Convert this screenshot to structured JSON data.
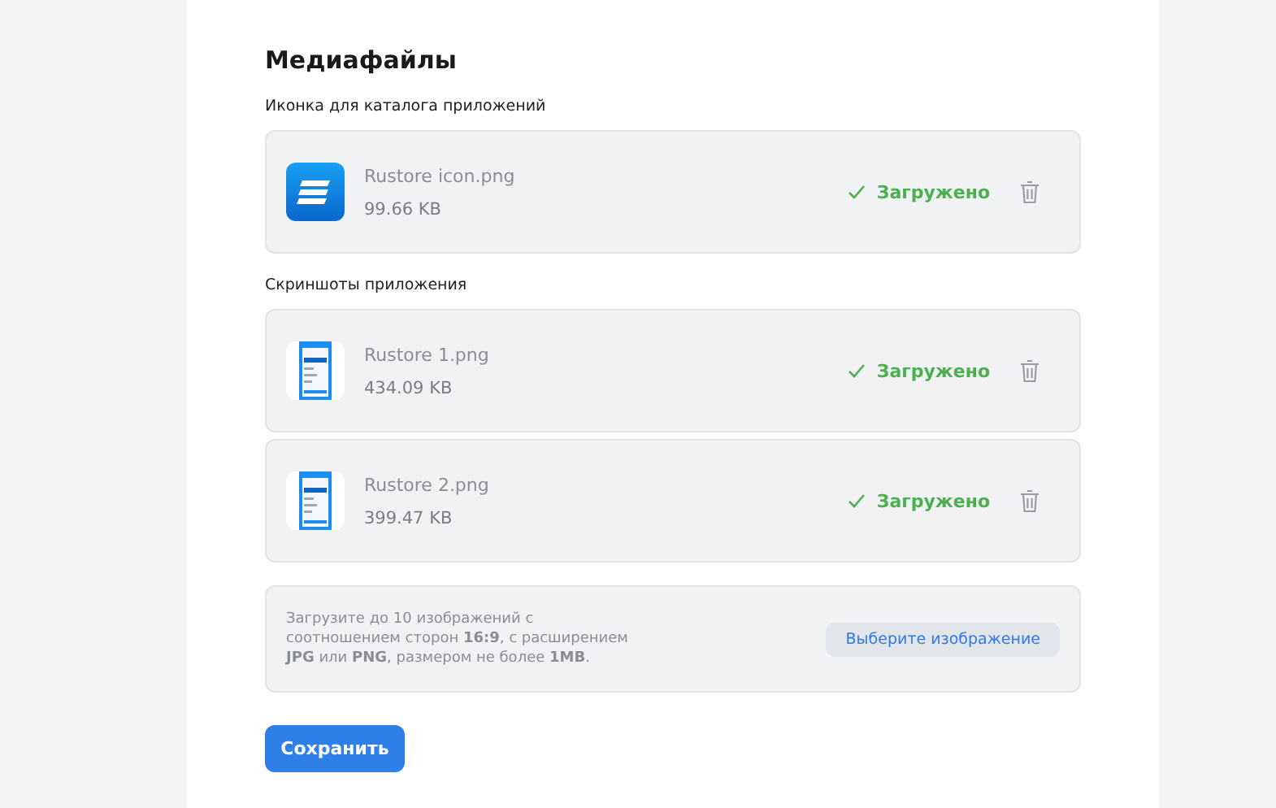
{
  "title": "Медиафайлы",
  "sections": [
    {
      "label": "Иконка для каталога приложений",
      "files": [
        {
          "kind": "logo",
          "name": "Rustore icon.png",
          "size": "99.66 KB",
          "status": "Загружено"
        }
      ]
    },
    {
      "label": "Скриншоты приложения",
      "files": [
        {
          "kind": "screenshot",
          "name": "Rustore 1.png",
          "size": "434.09 KB",
          "status": "Загружено"
        },
        {
          "kind": "screenshot",
          "name": "Rustore 2.png",
          "size": "399.47 KB",
          "status": "Загружено"
        }
      ]
    }
  ],
  "upload": {
    "hint": "Загрузите до 10 изображений с соотношением сторон **16:9**, с расширением **JPG** или **PNG**, размером не более **1MB**.",
    "button": "Выберите изображение"
  },
  "save_button": "Сохранить"
}
